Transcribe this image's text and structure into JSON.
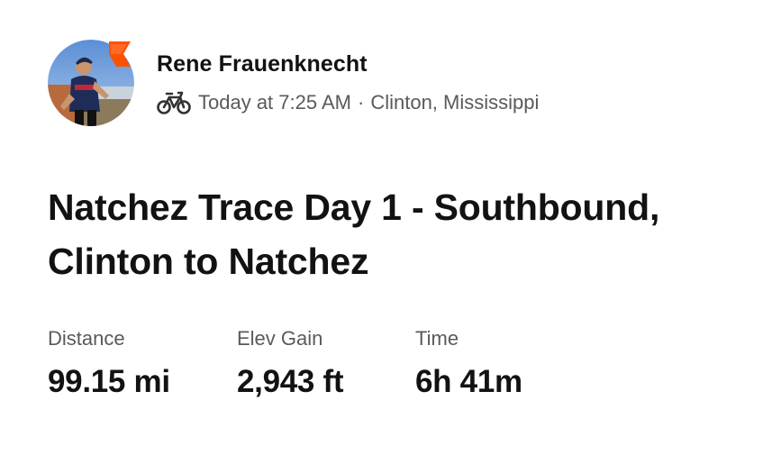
{
  "athlete": {
    "name": "Rene Frauenknecht",
    "avatar_icon": "athlete-avatar-cyclist",
    "badge_icon": "subscriber-badge-icon",
    "badge_color": "#fc5200"
  },
  "activity": {
    "type_icon": "bike-icon",
    "timestamp": "Today at 7:25 AM",
    "separator": "·",
    "location": "Clinton, Mississippi",
    "title": "Natchez Trace Day 1 - Southbound, Clinton to Natchez"
  },
  "stats": [
    {
      "label": "Distance",
      "value": "99.15 mi"
    },
    {
      "label": "Elev Gain",
      "value": "2,943 ft"
    },
    {
      "label": "Time",
      "value": "6h 41m"
    }
  ],
  "colors": {
    "text_primary": "#121212",
    "text_secondary": "#5a5a5a",
    "brand_orange": "#fc5200"
  }
}
